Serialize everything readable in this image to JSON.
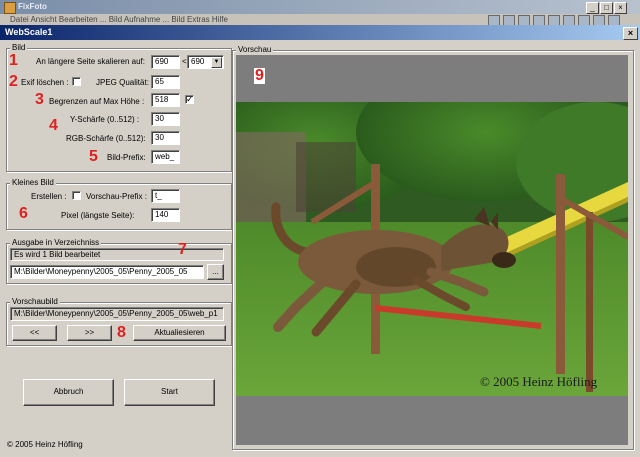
{
  "background_app": {
    "title": "FixFoto",
    "menu": "Datei  Ansicht  Bearbeiten  ...  Bild  Aufnahme  ...  Bild  Extras  Hilfe",
    "window_buttons": [
      "_",
      "□",
      "×"
    ]
  },
  "window": {
    "title": "WebScale1",
    "close": "×"
  },
  "bild": {
    "group_label": "Bild",
    "scale_label": "An längere Seite skalieren auf:",
    "scale_value": "690",
    "lt": "<",
    "scale_combo": "690",
    "exif_label": "Exif löschen :",
    "jpeg_label": "JPEG Qualität:",
    "jpeg_value": "65",
    "maxh_label": "Begrenzen auf Max Höhe :",
    "maxh_value": "518",
    "maxh_checked": "✓",
    "y_label": "Y-Schärfe (0..512) :",
    "y_value": "30",
    "rgb_label": "RGB-Schärfe (0..512):",
    "rgb_value": "30",
    "prefix_label": "Bild-Prefix:",
    "prefix_value": "web_"
  },
  "kleines_bild": {
    "group_label": "Kleines Bild",
    "create_label": "Erstellen :",
    "vprefix_label": "Vorschau-Prefix :",
    "vprefix_value": "t_",
    "pixel_label": "Pixel (längste Seite):",
    "pixel_value": "140"
  },
  "ausgabe": {
    "group_label": "Ausgabe in Verzeichniss",
    "status": "Es wird 1 Bild bearbeitet",
    "path": "M:\\Bilder\\Moneypenny\\2005_05\\Penny_2005_05",
    "browse": "..."
  },
  "vorschaubild": {
    "group_label": "Vorschaubild",
    "file": "M:\\Bilder\\Moneypenny\\2005_05\\Penny_2005_05\\web_p1",
    "prev": "<<",
    "next": ">>",
    "refresh": "Aktualiesieren"
  },
  "actions": {
    "cancel": "Abbruch",
    "start": "Start"
  },
  "footer": "© 2005 Heinz Höfling",
  "vorschau": {
    "group_label": "Vorschau",
    "watermark": "© 2005 Heinz Höfling"
  },
  "markers": [
    "1",
    "2",
    "3",
    "4",
    "5",
    "6",
    "7",
    "8",
    "9"
  ],
  "colors": {
    "marker": "#e02020",
    "titlebar_start": "#0a246a",
    "titlebar_end": "#a6caf0",
    "face": "#d4d0c8"
  }
}
